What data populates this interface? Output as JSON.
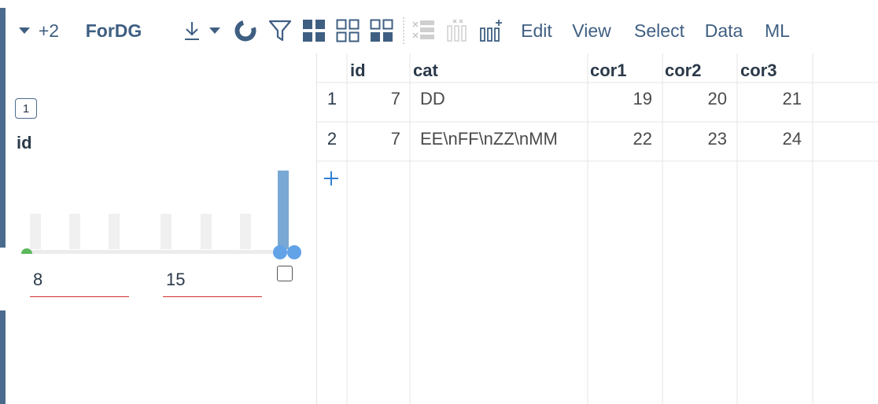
{
  "toolbar": {
    "more_count": "+2",
    "title": "ForDG",
    "menu": [
      "Edit",
      "View",
      "Select",
      "Data",
      "ML"
    ],
    "icons": [
      "caret-down-icon",
      "download-icon",
      "caret-down-icon",
      "refresh-icon",
      "filter-icon",
      "grid-layout-icon",
      "grid-layout-icon",
      "grid-layout-icon",
      "add-rows-icon",
      "add-columns-icon",
      "add-column-icon"
    ]
  },
  "filter": {
    "badge": "1",
    "column": "id",
    "min_value": "8",
    "max_value": "15",
    "histogram_fractions": [
      0.45,
      0.45,
      0.45,
      0.45,
      0.45,
      0.45,
      1.0
    ]
  },
  "grid": {
    "columns": [
      "id",
      "cat",
      "cor1",
      "cor2",
      "cor3"
    ],
    "rows": [
      {
        "num": "1",
        "id": "7",
        "cat": "DD",
        "cor1": "19",
        "cor2": "20",
        "cor3": "21"
      },
      {
        "num": "2",
        "id": "7",
        "cat": "EE\\nFF\\nZZ\\nMM",
        "cor1": "22",
        "cor2": "23",
        "cor3": "24"
      }
    ]
  },
  "colors": {
    "accent": "#3f5f82",
    "slider_handle": "#62a3e8",
    "slider_min": "#5cb85c",
    "hist_bar": "#f0f0f0",
    "hist_bar_active": "#7aa8d4",
    "input_underline": "#d03030"
  }
}
